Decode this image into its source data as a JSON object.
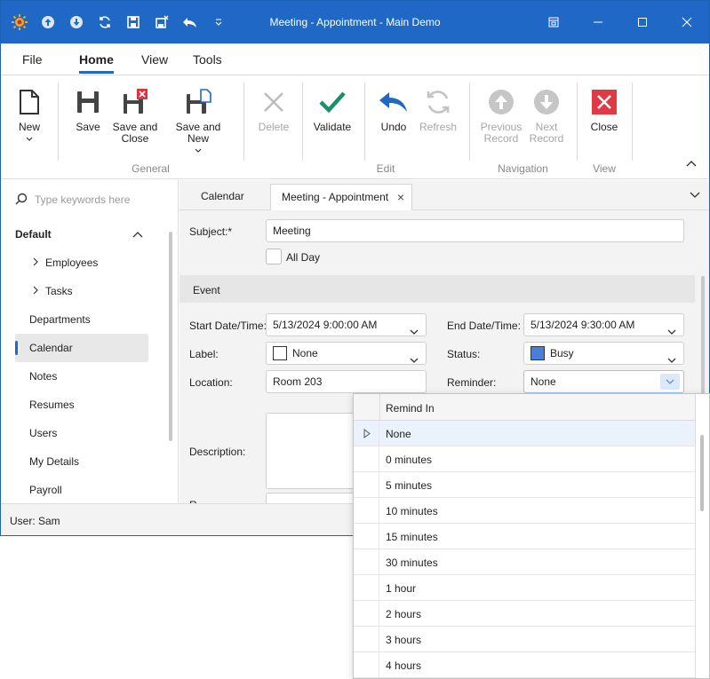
{
  "window": {
    "title": "Meeting - Appointment - Main Demo",
    "accent": "#1f68c6"
  },
  "ribbon_tabs": [
    "File",
    "Home",
    "View",
    "Tools"
  ],
  "ribbon": {
    "new": "New",
    "save": "Save",
    "save_close_1": "Save and",
    "save_close_2": "Close",
    "save_new": "Save and New",
    "delete": "Delete",
    "validate": "Validate",
    "undo": "Undo",
    "refresh": "Refresh",
    "prev_1": "Previous",
    "prev_2": "Record",
    "next_1": "Next",
    "next_2": "Record",
    "close": "Close",
    "groups": [
      "General",
      "Edit",
      "Navigation",
      "View"
    ]
  },
  "nav": {
    "search_placeholder": "Type keywords here",
    "group": "Default",
    "items": [
      "Employees",
      "Tasks",
      "Departments",
      "Calendar",
      "Notes",
      "Resumes",
      "Users",
      "My Details",
      "Payroll"
    ]
  },
  "status": {
    "user": "User: Sam"
  },
  "doc_tabs": [
    "Calendar",
    "Meeting - Appointment"
  ],
  "form": {
    "subject_label": "Subject:*",
    "subject_value": "Meeting",
    "allday_label": "All Day",
    "section": "Event",
    "start_label": "Start Date/Time:",
    "start_value": "5/13/2024 9:00:00 AM",
    "end_label": "End Date/Time:",
    "end_value": "5/13/2024 9:30:00 AM",
    "label_label": "Label:",
    "label_value": "None",
    "status_label": "Status:",
    "status_value": "Busy",
    "status_color": "#4a7fd8",
    "location_label": "Location:",
    "location_value": "Room 203",
    "reminder_label": "Reminder:",
    "reminder_value": "None",
    "description_label": "Description:",
    "partial_label": "R"
  },
  "popup": {
    "header": "Remind In",
    "options": [
      "None",
      "0 minutes",
      "5 minutes",
      "10 minutes",
      "15 minutes",
      "30 minutes",
      "1 hour",
      "2 hours",
      "3 hours",
      "4 hours"
    ]
  }
}
